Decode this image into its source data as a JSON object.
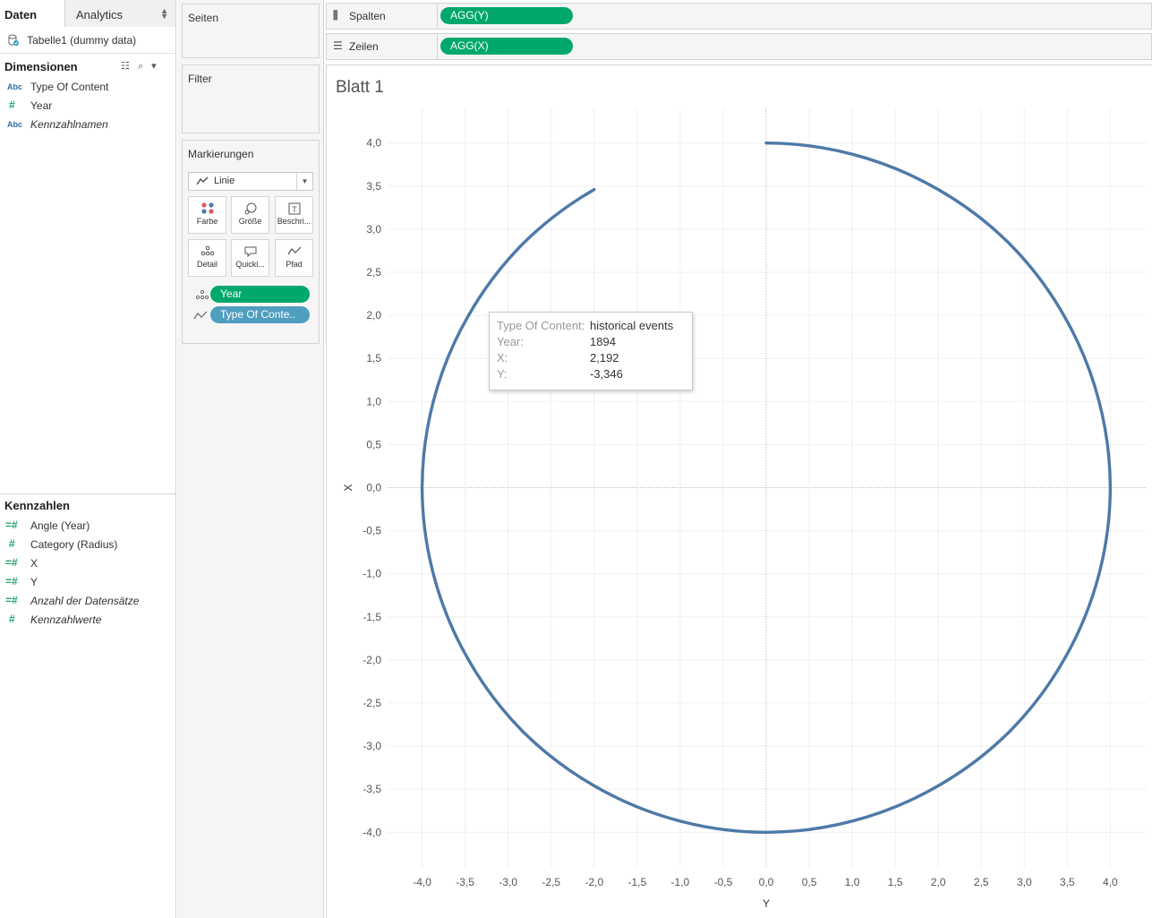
{
  "data_pane": {
    "tabs": {
      "data": "Daten",
      "analytics": "Analytics"
    },
    "datasource": "Tabelle1 (dummy data)",
    "dimensions_title": "Dimensionen",
    "dimensions": [
      {
        "icon": "Abc",
        "label": "Type Of Content",
        "italic": false
      },
      {
        "icon": "#",
        "label": "Year",
        "italic": false
      },
      {
        "icon": "Abc",
        "label": "Kennzahlnamen",
        "italic": true
      }
    ],
    "measures_title": "Kennzahlen",
    "measures": [
      {
        "icon": "=#",
        "label": "Angle (Year)",
        "italic": false
      },
      {
        "icon": "#",
        "label": "Category (Radius)",
        "italic": false
      },
      {
        "icon": "=#",
        "label": "X",
        "italic": false
      },
      {
        "icon": "=#",
        "label": "Y",
        "italic": false
      },
      {
        "icon": "=#",
        "label": "Anzahl der Datensätze",
        "italic": true
      },
      {
        "icon": "#",
        "label": "Kennzahlwerte",
        "italic": true
      }
    ]
  },
  "cards": {
    "pages": "Seiten",
    "filter": "Filter",
    "marks": "Markierungen",
    "mark_type": "Linie",
    "mark_buttons": {
      "color": "Farbe",
      "size": "Größe",
      "label": "Beschri...",
      "detail": "Detail",
      "tooltip": "Quickl...",
      "path": "Pfad"
    },
    "mark_pills": {
      "year": "Year",
      "type": "Type Of Conte.."
    }
  },
  "shelves": {
    "columns_label": "Spalten",
    "columns_pill": "AGG(Y)",
    "rows_label": "Zeilen",
    "rows_pill": "AGG(X)"
  },
  "sheet_title": "Blatt 1",
  "tooltip": {
    "type_key": "Type Of Content:",
    "type_val": "historical events",
    "year_key": "Year:",
    "year_val": "1894",
    "x_key": "X:",
    "x_val": "2,192",
    "y_key": "Y:",
    "y_val": "-3,346"
  },
  "colors": {
    "line": "#4e79a7",
    "pill_green": "#00a86b",
    "pill_blue": "#4f9dbf"
  },
  "chart_data": {
    "type": "line",
    "x_field": "Y",
    "y_field": "X",
    "xlabel": "Y",
    "ylabel": "X",
    "xlim": [
      -4.35,
      4.4
    ],
    "ylim": [
      -4.35,
      4.4
    ],
    "x_ticks": [
      "-4,0",
      "-3,5",
      "-3,0",
      "-2,5",
      "-2,0",
      "-1,5",
      "-1,0",
      "-0,5",
      "0,0",
      "0,5",
      "1,0",
      "1,5",
      "2,0",
      "2,5",
      "3,0",
      "3,5",
      "4,0"
    ],
    "y_ticks": [
      "4,0",
      "3,5",
      "3,0",
      "2,5",
      "2,0",
      "1,5",
      "1,0",
      "0,5",
      "0,0",
      "-0,5",
      "-1,0",
      "-1,5",
      "-2,0",
      "-2,5",
      "-3,0",
      "-3,5",
      "-4,0"
    ],
    "tick_values": [
      -4,
      -3.5,
      -3,
      -2.5,
      -2,
      -1.5,
      -1,
      -0.5,
      0,
      0.5,
      1,
      1.5,
      2,
      2.5,
      3,
      3.5,
      4
    ],
    "series": [
      {
        "description": "arc of radius 4 starting at top (0,4), running clockwise around to (-2,3.46)",
        "points": [
          [
            0,
            4.0
          ],
          [
            1.0,
            3.87
          ],
          [
            2.0,
            3.46
          ],
          [
            2.83,
            2.83
          ],
          [
            3.46,
            2.0
          ],
          [
            3.87,
            1.0
          ],
          [
            4.0,
            0.0
          ],
          [
            3.87,
            -1.0
          ],
          [
            3.46,
            -2.0
          ],
          [
            2.83,
            -2.83
          ],
          [
            2.0,
            -3.46
          ],
          [
            1.0,
            -3.87
          ],
          [
            0.0,
            -4.0
          ],
          [
            -1.0,
            -3.87
          ],
          [
            -2.0,
            -3.46
          ],
          [
            -2.83,
            -2.83
          ],
          [
            -3.46,
            -2.0
          ],
          [
            -3.87,
            -1.0
          ],
          [
            -4.0,
            0.0
          ],
          [
            -3.87,
            1.0
          ],
          [
            -3.46,
            2.0
          ],
          [
            -2.83,
            2.83
          ],
          [
            -2.0,
            3.46
          ]
        ]
      }
    ],
    "grid": true
  }
}
